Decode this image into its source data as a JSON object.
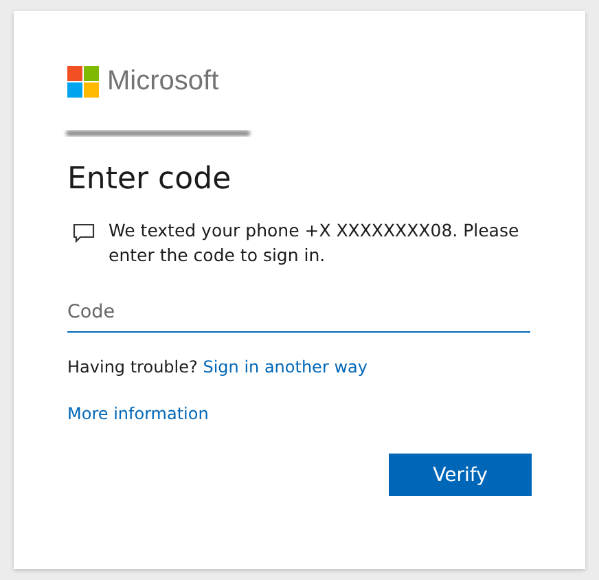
{
  "brand": {
    "name": "Microsoft"
  },
  "heading": "Enter code",
  "message": "We texted your phone +X XXXXXXXX08. Please enter the code to sign in.",
  "code_field": {
    "placeholder": "Code"
  },
  "trouble": {
    "text": "Having trouble?",
    "link": "Sign in another way"
  },
  "more_info_link": "More information",
  "buttons": [
    {
      "label": "Verify",
      "kind": "primary"
    }
  ]
}
